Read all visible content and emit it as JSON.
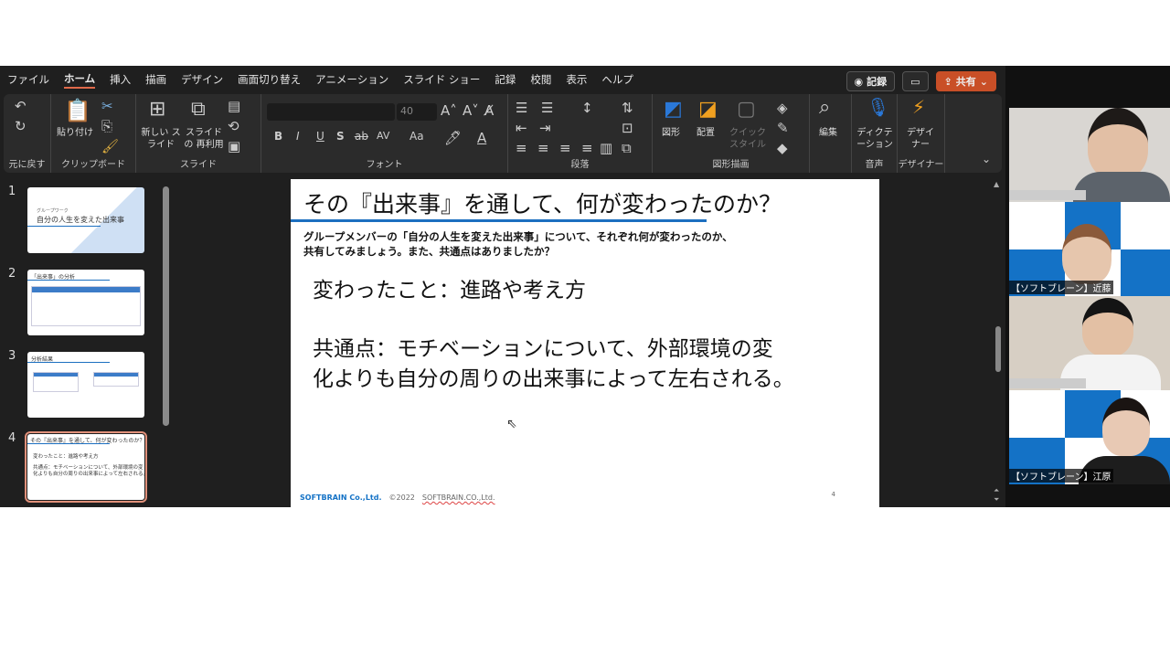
{
  "menu": {
    "tabs": [
      "ファイル",
      "ホーム",
      "挿入",
      "描画",
      "デザイン",
      "画面切り替え",
      "アニメーション",
      "スライド ショー",
      "記録",
      "校閲",
      "表示",
      "ヘルプ"
    ],
    "active": "ホーム",
    "record": "記録",
    "share": "共有"
  },
  "ribbon": {
    "undo": {
      "label": "元に戻す"
    },
    "clipboard": {
      "paste": "貼り付け",
      "label": "クリップボード"
    },
    "slides": {
      "new": "新しい スライド",
      "reuse": "スライドの 再利用",
      "label": "スライド"
    },
    "font": {
      "size": "40",
      "bold": "B",
      "italic": "I",
      "underline": "U",
      "shadow": "S",
      "case": "Aa",
      "label": "フォント"
    },
    "paragraph": {
      "label": "段落"
    },
    "drawing": {
      "shapes": "図形",
      "arrange": "配置",
      "quick_style": "クイック スタイル",
      "label": "図形描画"
    },
    "editing": {
      "label": "編集"
    },
    "voice": {
      "dictate": "ディクテーション",
      "label": "音声"
    },
    "designer": {
      "button": "デザイナー",
      "label": "デザイナー"
    }
  },
  "thumbnails": [
    {
      "num": "1",
      "title": "自分の人生を変えた出来事",
      "subtitle": "グループワーク"
    },
    {
      "num": "2",
      "title": "「出来事」の分析"
    },
    {
      "num": "3",
      "title": "分析結果"
    },
    {
      "num": "4",
      "title": "その『出来事』を通して、何が変わったのか？"
    }
  ],
  "slide": {
    "title": "その『出来事』を通して、何が変わったのか？",
    "subtitle_line1": "グループメンバーの「自分の人生を変えた出来事」について、それぞれ何が変わったのか、",
    "subtitle_line2": "共有してみましょう。また、共通点はありましたか？",
    "body1": "変わったこと：進路や考え方",
    "body2_line1": "共通点：モチベーションについて、外部環境の変",
    "body2_line2": "化よりも自分の周りの出来事によって左右される。",
    "footer_logo": "SOFTBRAIN Co.,Ltd.",
    "footer_copy": "©2022",
    "footer_company": "SOFTBRAIN.CO.,Ltd.",
    "page": "4"
  },
  "participants": [
    {
      "name": ""
    },
    {
      "name": "【ソフトブレーン】近藤"
    },
    {
      "name": ""
    },
    {
      "name": "【ソフトブレーン】江原"
    }
  ],
  "colors": {
    "accent": "#c94f27",
    "slide_line": "#1c6fc0",
    "brand_blue": "#1472c6"
  }
}
